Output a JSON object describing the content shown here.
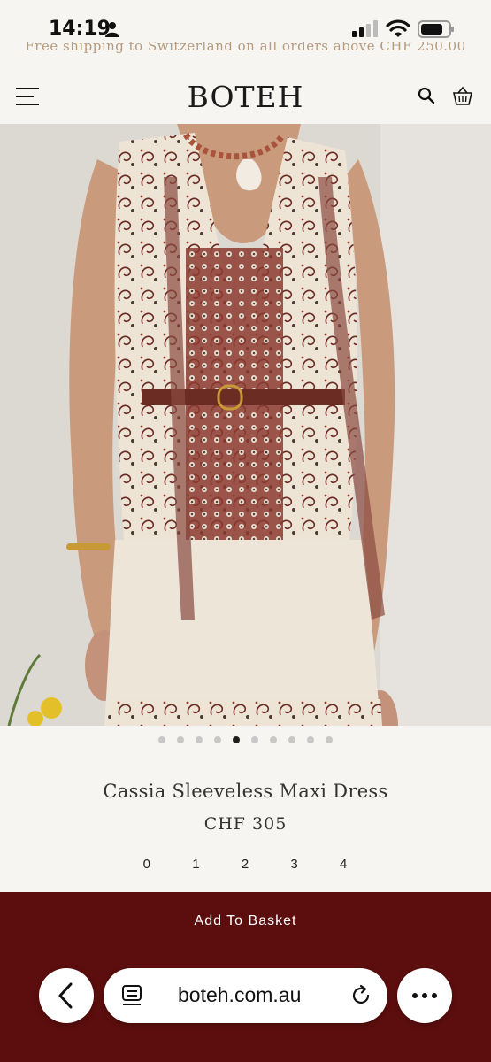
{
  "status_bar": {
    "time": "14:19",
    "icons": [
      "person-icon",
      "signal-icon",
      "wifi-icon",
      "battery-icon"
    ]
  },
  "promo": {
    "text": "Free shipping to Switzerland on all orders above CHF 250.00",
    "color": "#b69a7e"
  },
  "header": {
    "logo": "BOTEH",
    "icons": [
      "menu-icon",
      "search-icon",
      "basket-icon"
    ]
  },
  "carousel": {
    "total": 10,
    "active_index": 4
  },
  "product": {
    "title": "Cassia Sleeveless Maxi Dress",
    "price": "CHF 305",
    "sizes": [
      "0",
      "1",
      "2",
      "3",
      "4"
    ]
  },
  "cta": {
    "label": "Add To Basket",
    "color": "#5b0e0d"
  },
  "browser": {
    "url": "boteh.com.au",
    "icons": [
      "back-icon",
      "tabs-icon",
      "reload-icon",
      "more-icon"
    ]
  }
}
